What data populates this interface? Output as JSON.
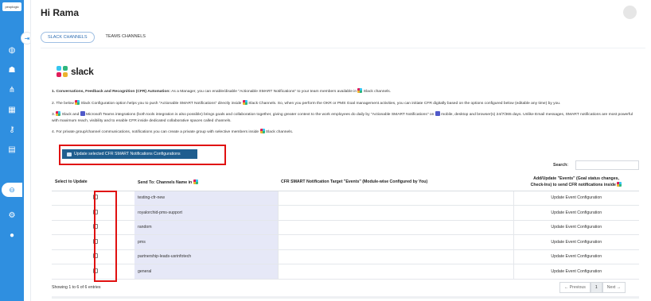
{
  "app": {
    "logo_text": "peoplogic"
  },
  "header": {
    "greeting": "Hi Rama"
  },
  "tabs": [
    {
      "label": "SLACK CHANNELS",
      "active": true
    },
    {
      "label": "TEAMS CHANNELS",
      "active": false
    }
  ],
  "brand": {
    "slack_word": "slack"
  },
  "paragraphs": {
    "p1_bold": "1. Conversations, Feedback and Recognition (CFR) Automation:",
    "p1_rest": " As a Manager, you can enable/disable \"Actionable SMART Notifications\" to your team members available in",
    "p1_end": " Slack channels.",
    "p2_a": "2. The below",
    "p2_b": " Slack Configuration option helps you to push \"Actionable SMART Notifications\" directly inside",
    "p2_c": " Slack Channels. So, when you perform the OKR or PMS Goal management activities, you can initiate CFR digitally based on the options configured below (editable any time) by you.",
    "p3_a": "3.",
    "p3_b": " Slack and",
    "p3_c": " Microsoft Teams integrations (both tools integration is also possible) brings goals and collaboration together, giving greater context to the work employees do daily by \"Actionable SMART Notifications\" on",
    "p3_d": " mobile, desktop and browser(s) 24/7/365 days. Unlike Email messages, SMART notifications are most powerful with maximum reach, visibility and to enable CFR inside dedicated collaborative spaces called channels.",
    "p4_a": "4. For private group/channel communications, notifications you can create a private group with selective members inside",
    "p4_b": " Slack channels."
  },
  "toolbar": {
    "update_button": "Update selected CFR SMART Notifications Configurations",
    "search_label": "Search:",
    "search_value": ""
  },
  "table": {
    "headers": {
      "select": "Select to Update",
      "send_to": "Send To: Channels Name in",
      "target": "CFR SMART Notification Target \"Events\" (Module-wise Configured by You)",
      "add_update_line1": "Add/Update \"Events\" (Goal status changes,",
      "add_update_line2": "Check-Ins) to send CFR notifications inside"
    },
    "rows": [
      {
        "channel": "testing-cfr-new",
        "target": "",
        "action": "Update Event Configuration"
      },
      {
        "channel": "royalorchid-pms-support",
        "target": "",
        "action": "Update Event Configuration"
      },
      {
        "channel": "random",
        "target": "",
        "action": "Update Event Configuration"
      },
      {
        "channel": "pms",
        "target": "",
        "action": "Update Event Configuration"
      },
      {
        "channel": "partnership-leads-usrinfotech",
        "target": "",
        "action": "Update Event Configuration"
      },
      {
        "channel": "general",
        "target": "",
        "action": "Update Event Configuration"
      }
    ]
  },
  "footer": {
    "info": "Showing 1 to 6 of 6 entries",
    "prev": "← Previous",
    "page": "1",
    "next": "Next →"
  },
  "colors": {
    "sidebar": "#2f8fe0",
    "button": "#1f5e8f",
    "highlight_box": "#e01010",
    "channel_cell": "#e6e8f7"
  }
}
